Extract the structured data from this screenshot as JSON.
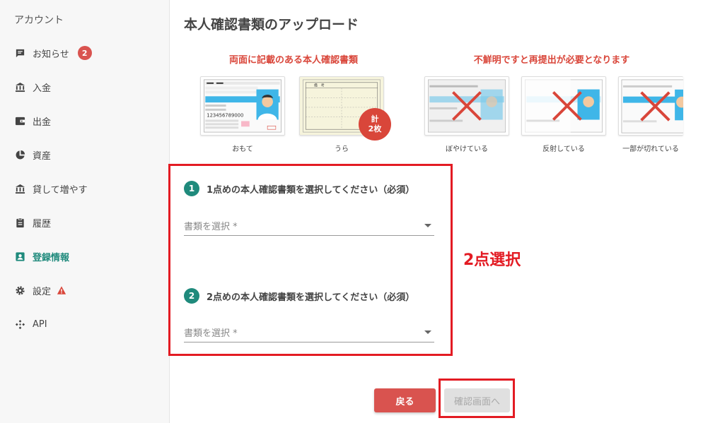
{
  "sidebar": {
    "title": "アカウント",
    "items": [
      {
        "label": "お知らせ",
        "badge": "2"
      },
      {
        "label": "入金"
      },
      {
        "label": "出金"
      },
      {
        "label": "資産"
      },
      {
        "label": "貸して増やす"
      },
      {
        "label": "履歴"
      },
      {
        "label": "登録情報"
      },
      {
        "label": "設定"
      },
      {
        "label": "API"
      }
    ]
  },
  "main": {
    "title": "本人確認書類のアップロード",
    "good_label": "両面に記載のある本人確認書類",
    "bad_label": "不鮮明ですと再提出が必要となります",
    "samples": [
      {
        "caption": "おもて"
      },
      {
        "caption": "うら"
      },
      {
        "caption": "ぼやけている"
      },
      {
        "caption": "反射している"
      },
      {
        "caption": "一部が切れている"
      }
    ],
    "count_badge": {
      "line1": "計",
      "line2": "2枚"
    },
    "card": {
      "number": "123456789000",
      "back_header": "備　考"
    },
    "step1": {
      "num": "1",
      "title": "1点めの本人確認書類を選択してください（必須）",
      "placeholder": "書類を選択 *"
    },
    "step2": {
      "num": "2",
      "title": "2点めの本人確認書類を選択してください（必須）",
      "placeholder": "書類を選択 *"
    },
    "annotation": "2点選択",
    "back_button": "戻る",
    "confirm_button": "確認画面へ"
  },
  "colors": {
    "accent": "#1f8a7c",
    "danger": "#d9463a",
    "highlight": "#e31b23"
  }
}
